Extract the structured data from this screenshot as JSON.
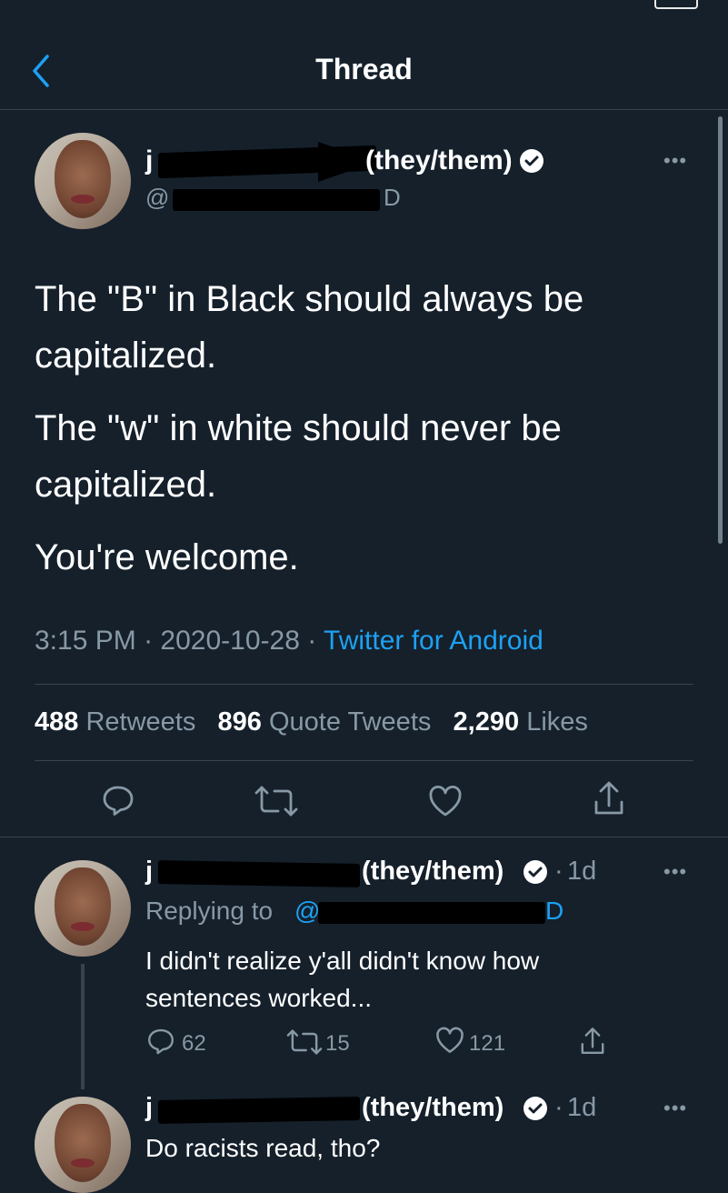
{
  "header": {
    "title": "Thread"
  },
  "main_tweet": {
    "name_suffix": "(they/them)",
    "name_initial": "j",
    "handle_prefix": "@",
    "handle_end": "D",
    "paragraphs": [
      "The \"B\" in Black should always be capitalized.",
      "The \"w\" in white should never be capitalized.",
      "You're welcome."
    ],
    "time": "3:15 PM",
    "date": "2020-10-28",
    "source": "Twitter for Android",
    "sep": "·",
    "retweets_count": "488",
    "retweets_label": "Retweets",
    "quotes_count": "896",
    "quotes_label": "Quote Tweets",
    "likes_count": "2,290",
    "likes_label": "Likes"
  },
  "reply1": {
    "name_initial": "j",
    "name_suffix": "(they/them)",
    "age": "1d",
    "replying_label": "Replying to",
    "replying_handle_prefix": "@",
    "replying_handle_end": "D",
    "text": "I didn't realize y'all didn't know how sentences worked...",
    "replies": "62",
    "retweets": "15",
    "likes": "121"
  },
  "reply2": {
    "name_initial": "j",
    "name_suffix": "(they/them)",
    "age": "1d",
    "text": "Do racists read, tho?"
  },
  "colors": {
    "background": "#15202b",
    "accent": "#1da1f2",
    "muted": "#8899a6",
    "divider": "#38444d"
  },
  "icons": [
    "back-chevron-icon",
    "verified-badge-icon",
    "more-dots-icon",
    "reply-icon",
    "retweet-icon",
    "like-icon",
    "share-icon"
  ]
}
